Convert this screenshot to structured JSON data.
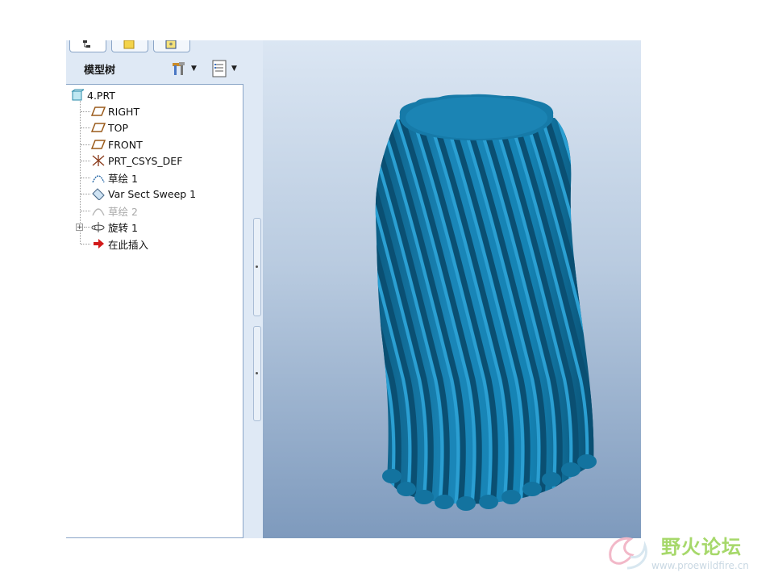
{
  "panel": {
    "title": "模型树",
    "tabs": [
      {
        "icon": "model-tree-tab-icon"
      },
      {
        "icon": "folder-tab-icon"
      },
      {
        "icon": "favorites-tab-icon"
      }
    ],
    "tools": [
      {
        "icon": "settings-tools-icon",
        "dropdown": true
      },
      {
        "icon": "show-columns-icon",
        "dropdown": true
      }
    ]
  },
  "tree": {
    "root": {
      "label": "4.PRT",
      "icon": "part-icon"
    },
    "items": [
      {
        "label": "RIGHT",
        "icon": "datum-plane-icon",
        "dim": false
      },
      {
        "label": "TOP",
        "icon": "datum-plane-icon",
        "dim": false
      },
      {
        "label": "FRONT",
        "icon": "datum-plane-icon",
        "dim": false
      },
      {
        "label": "PRT_CSYS_DEF",
        "icon": "coordinate-system-icon",
        "dim": false
      },
      {
        "label": "草绘 1",
        "icon": "sketch-icon",
        "dim": false
      },
      {
        "label": "Var Sect Sweep 1",
        "icon": "variable-sweep-icon",
        "dim": false
      },
      {
        "label": "草绘 2",
        "icon": "sketch-icon",
        "dim": true
      },
      {
        "label": "旋转 1",
        "icon": "revolve-icon",
        "dim": false,
        "expandable": true
      },
      {
        "label": "在此插入",
        "icon": "insert-here-arrow-icon",
        "dim": false
      }
    ]
  },
  "viewport": {
    "model": "twisted-fluted-column-model",
    "model_color": "#1a86b8",
    "background_top": "#dbe6f3",
    "background_bottom": "#7e9abd"
  },
  "watermark": {
    "text": "野火论坛",
    "url": "www.proewildfire.cn"
  }
}
